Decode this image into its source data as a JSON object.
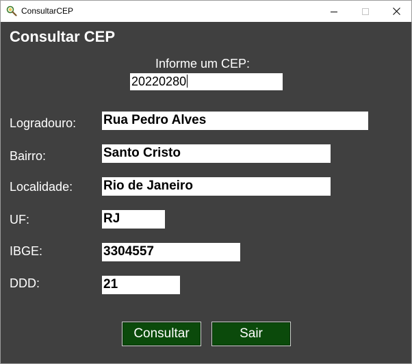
{
  "window": {
    "title": "ConsultarCEP",
    "app_icon": "magnifier-icon"
  },
  "main": {
    "heading": "Consultar CEP",
    "cep_prompt": "Informe um CEP:",
    "cep_value": "20220280"
  },
  "fields": {
    "logradouro": {
      "label": "Logradouro:",
      "value": "Rua Pedro Alves"
    },
    "bairro": {
      "label": "Bairro:",
      "value": "Santo Cristo"
    },
    "localidade": {
      "label": "Localidade:",
      "value": "Rio de Janeiro"
    },
    "uf": {
      "label": "UF:",
      "value": "RJ"
    },
    "ibge": {
      "label": "IBGE:",
      "value": "3304557"
    },
    "ddd": {
      "label": "DDD:",
      "value": "21"
    }
  },
  "buttons": {
    "consultar": "Consultar",
    "sair": "Sair"
  },
  "colors": {
    "background": "#404040",
    "button": "#0b4a0b",
    "text": "#ffffff"
  }
}
